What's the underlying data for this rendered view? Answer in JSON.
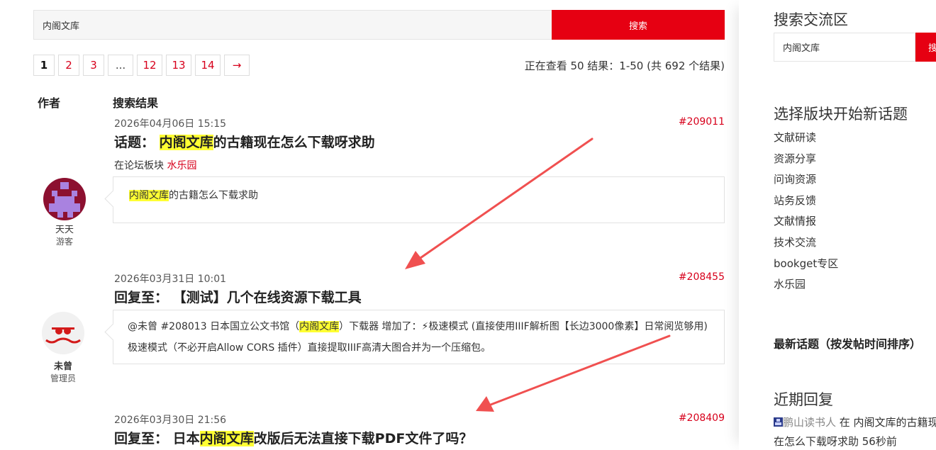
{
  "search": {
    "value": "内阁文库",
    "button": "搜索"
  },
  "pagination": {
    "pages": [
      "1",
      "2",
      "3",
      "...",
      "12",
      "13",
      "14"
    ],
    "next": "→",
    "current": "1"
  },
  "result_count": "正在查看 50 结果：1-50 (共 692 个结果)",
  "columns": {
    "author": "作者",
    "results": "搜索结果"
  },
  "results": [
    {
      "date": "2026年04月06日 15:15",
      "id": "#209011",
      "title_prefix": "话题：",
      "title_hl": "内阁文库",
      "title_rest": "的古籍现在怎么下载呀求助",
      "forum_label": "在论坛板块",
      "forum_name": "水乐园",
      "excerpt_hl": "内阁文库",
      "excerpt_rest": "的古籍怎么下载求助",
      "author": "天天",
      "role": "游客"
    },
    {
      "date": "2026年03月31日 10:01",
      "id": "#208455",
      "title_prefix": "回复至：",
      "title_rest": "【测试】几个在线资源下载工具",
      "excerpt_a": "@未曾 #208013 日本国立公文书馆（",
      "excerpt_hl": "内阁文库",
      "excerpt_b": "）下载器 增加了：⚡极速模式 (直接使用IIIF解析图【长边3000像素】日常阅览够用) 极速模式（不必开启Allow CORS 插件）直接提取IIIF高清大图合并为一个压缩包。",
      "author": "未曾",
      "role": "管理员"
    },
    {
      "date": "2026年03月30日 21:56",
      "id": "#208409",
      "title_prefix": "回复至：",
      "title_a": "日本",
      "title_hl": "内阁文库",
      "title_rest": "改版后无法直接下载PDF文件了吗？"
    }
  ],
  "sidebar": {
    "search_title": "搜索交流区",
    "search_value": "内阁文库",
    "search_button": "搜",
    "forums_title": "选择版块开始新话题",
    "forums": [
      "文献研读",
      "资源分享",
      "问询资源",
      "站务反馈",
      "文献情报",
      "技术交流",
      "bookget专区",
      "水乐园"
    ],
    "latest_title": "最新话题（按发帖时间排序）",
    "recent_title": "近期回复",
    "recent_user": "鹏山读书人",
    "recent_text": " 在 内阁文库的古籍现在怎么下载呀求助 56秒前"
  },
  "colors": {
    "accent": "#e60012",
    "link": "#d7001b",
    "highlight": "#ffff33",
    "arrow": "#f05050"
  }
}
